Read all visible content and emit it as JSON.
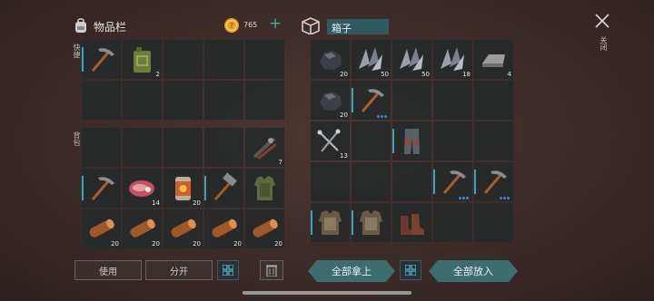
{
  "inventory": {
    "title": "物品栏",
    "coins": "765",
    "add": "+",
    "quick_label": "快捷",
    "bag_label": "背包",
    "quick_slots": [
      {
        "icon": "pickaxe-icon",
        "count": "",
        "active": true
      },
      {
        "icon": "fuel-can-icon",
        "count": "2",
        "active": false
      },
      {
        "icon": "",
        "count": "",
        "active": false
      },
      {
        "icon": "",
        "count": "",
        "active": false
      },
      {
        "icon": "",
        "count": "",
        "active": false
      },
      {
        "icon": "",
        "count": "",
        "active": false
      },
      {
        "icon": "",
        "count": "",
        "active": false
      },
      {
        "icon": "",
        "count": "",
        "active": false
      },
      {
        "icon": "",
        "count": "",
        "active": false
      },
      {
        "icon": "",
        "count": "",
        "active": false
      }
    ],
    "bag_slots": [
      {
        "icon": "",
        "count": ""
      },
      {
        "icon": "",
        "count": ""
      },
      {
        "icon": "",
        "count": ""
      },
      {
        "icon": "",
        "count": ""
      },
      {
        "icon": "tool-bundle-icon",
        "count": "7"
      },
      {
        "icon": "pickaxe-icon",
        "count": "",
        "active": true
      },
      {
        "icon": "raw-meat-icon",
        "count": "14"
      },
      {
        "icon": "canned-food-icon",
        "count": "20"
      },
      {
        "icon": "hammer-icon",
        "count": "",
        "active": true
      },
      {
        "icon": "armor-vest-icon",
        "count": ""
      },
      {
        "icon": "wood-log-icon",
        "count": "20"
      },
      {
        "icon": "wood-log-icon",
        "count": "20"
      },
      {
        "icon": "wood-log-icon",
        "count": "20"
      },
      {
        "icon": "wood-log-icon",
        "count": "20"
      },
      {
        "icon": "wood-log-icon",
        "count": "20"
      }
    ],
    "buttons": {
      "use": "使用",
      "split": "分开"
    }
  },
  "box": {
    "title": "箱子",
    "close_label": "关闭",
    "slots": [
      {
        "icon": "coal-ore-icon",
        "count": "20"
      },
      {
        "icon": "iron-ore-icon",
        "count": "50"
      },
      {
        "icon": "iron-ore-icon",
        "count": "50"
      },
      {
        "icon": "iron-ore-icon",
        "count": "18"
      },
      {
        "icon": "metal-ingot-icon",
        "count": "4"
      },
      {
        "icon": "coal-ore-icon",
        "count": "20"
      },
      {
        "icon": "pickaxe-icon",
        "count": "",
        "dots": true,
        "active": true
      },
      {
        "icon": "",
        "count": ""
      },
      {
        "icon": "",
        "count": ""
      },
      {
        "icon": "",
        "count": ""
      },
      {
        "icon": "nails-icon",
        "count": "13"
      },
      {
        "icon": "",
        "count": ""
      },
      {
        "icon": "armored-pants-icon",
        "count": "",
        "active": true
      },
      {
        "icon": "",
        "count": ""
      },
      {
        "icon": "",
        "count": ""
      },
      {
        "icon": "",
        "count": ""
      },
      {
        "icon": "",
        "count": ""
      },
      {
        "icon": "",
        "count": ""
      },
      {
        "icon": "pickaxe-icon",
        "count": "",
        "dots": true,
        "active": true
      },
      {
        "icon": "pickaxe-icon",
        "count": "",
        "dots": true,
        "active": true
      },
      {
        "icon": "armor-chest-icon",
        "count": "",
        "active": true
      },
      {
        "icon": "armor-chest-icon",
        "count": "",
        "active": true
      },
      {
        "icon": "boots-icon",
        "count": ""
      },
      {
        "icon": "",
        "count": ""
      },
      {
        "icon": "",
        "count": ""
      }
    ],
    "buttons": {
      "take_all": "全部拿上",
      "put_all": "全部放入"
    }
  },
  "colors": {
    "accent": "#36a8b8",
    "coin": "#e3a12a",
    "teal_button": "#3c6d6f"
  }
}
